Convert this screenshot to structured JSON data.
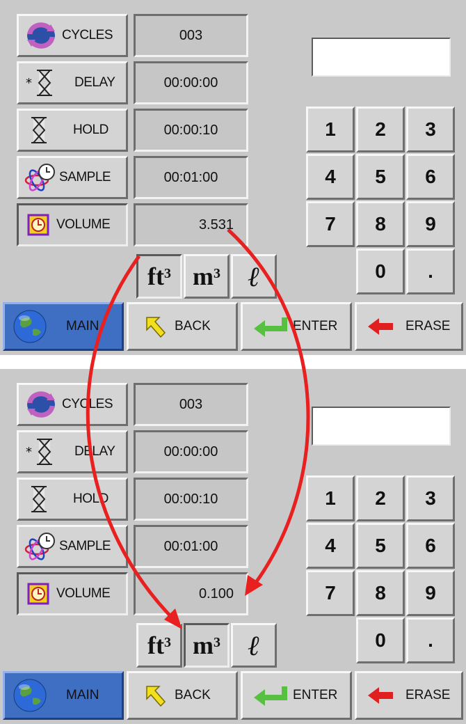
{
  "panels": [
    {
      "params": [
        {
          "label": "CYCLES",
          "value": "003",
          "icon": "cycle-arrows-icon"
        },
        {
          "label": "DELAY",
          "value": "00:00:00",
          "icon": "hourglass-star-icon"
        },
        {
          "label": "HOLD",
          "value": "00:00:10",
          "icon": "hourglass-icon"
        },
        {
          "label": "SAMPLE",
          "value": "00:01:00",
          "icon": "atom-clock-icon"
        },
        {
          "label": "VOLUME",
          "value": "3.531",
          "icon": "clock-cube-icon"
        }
      ],
      "display_value": "",
      "selected_unit": "ft3"
    },
    {
      "params": [
        {
          "label": "CYCLES",
          "value": "003",
          "icon": "cycle-arrows-icon"
        },
        {
          "label": "DELAY",
          "value": "00:00:00",
          "icon": "hourglass-star-icon"
        },
        {
          "label": "HOLD",
          "value": "00:00:10",
          "icon": "hourglass-icon"
        },
        {
          "label": "SAMPLE",
          "value": "00:01:00",
          "icon": "atom-clock-icon"
        },
        {
          "label": "VOLUME",
          "value": "0.100",
          "icon": "clock-cube-icon"
        }
      ],
      "display_value": "",
      "selected_unit": "m3"
    }
  ],
  "units": {
    "ft": "ft",
    "m": "m",
    "exp": "3",
    "liter": "ℓ"
  },
  "keypad": [
    "1",
    "2",
    "3",
    "4",
    "5",
    "6",
    "7",
    "8",
    "9",
    "0",
    "."
  ],
  "bottom": {
    "main": "MAIN",
    "back": "BACK",
    "enter": "ENTER",
    "erase": "ERASE"
  },
  "colors": {
    "panel": "#c9c9c9",
    "main_button": "#3f6fc2",
    "arrow": "#e82020",
    "back_icon": "#f2e020",
    "enter_icon": "#58c040",
    "erase_icon": "#e02020"
  }
}
